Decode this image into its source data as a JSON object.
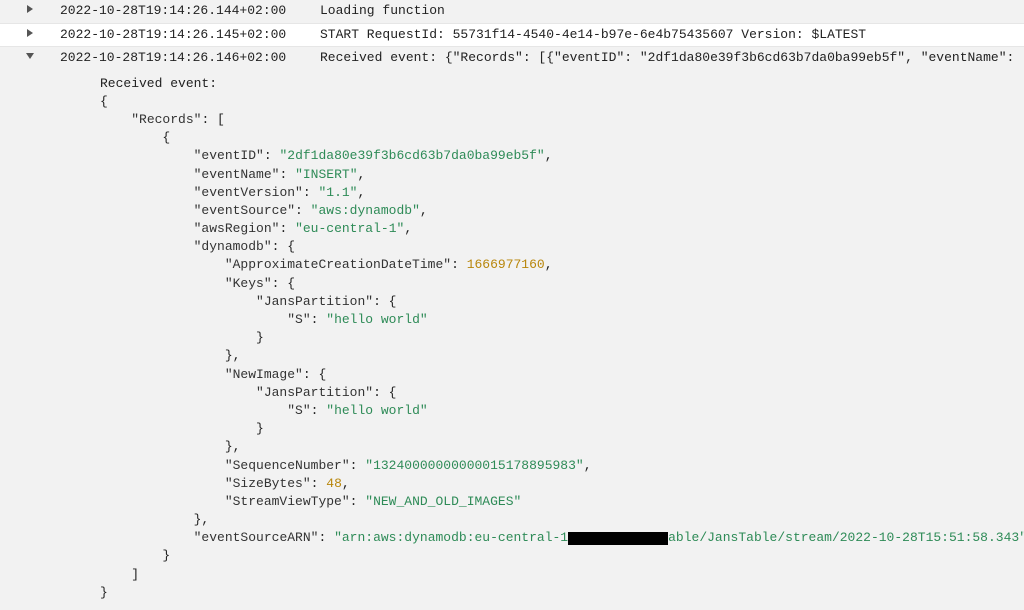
{
  "rows": [
    {
      "timestamp": "2022-10-28T19:14:26.144+02:00",
      "message": "Loading function",
      "expanded": false
    },
    {
      "timestamp": "2022-10-28T19:14:26.145+02:00",
      "message": "START RequestId: 55731f14-4540-4e14-b97e-6e4b75435607 Version: $LATEST",
      "expanded": false
    },
    {
      "timestamp": "2022-10-28T19:14:26.146+02:00",
      "message": "Received event: {\"Records\": [{\"eventID\": \"2df1da80e39f3b6cd63b7da0ba99eb5f\", \"eventName\":",
      "expanded": true
    }
  ],
  "expanded_header": "Received event:",
  "json": {
    "eventID": "2df1da80e39f3b6cd63b7da0ba99eb5f",
    "eventName": "INSERT",
    "eventVersion": "1.1",
    "eventSource": "aws:dynamodb",
    "awsRegion": "eu-central-1",
    "ApproximateCreationDateTime": 1666977160,
    "Keys_JansPartition_S": "hello world",
    "NewImage_JansPartition_S": "hello world",
    "SequenceNumber": "13240000000000015178895983",
    "SizeBytes": 48,
    "StreamViewType": "NEW_AND_OLD_IMAGES",
    "eventSourceARN_prefix": "arn:aws:dynamodb:eu-central-1",
    "eventSourceARN_suffix": "able/JansTable/stream/2022-10-28T15:51:58.343"
  }
}
